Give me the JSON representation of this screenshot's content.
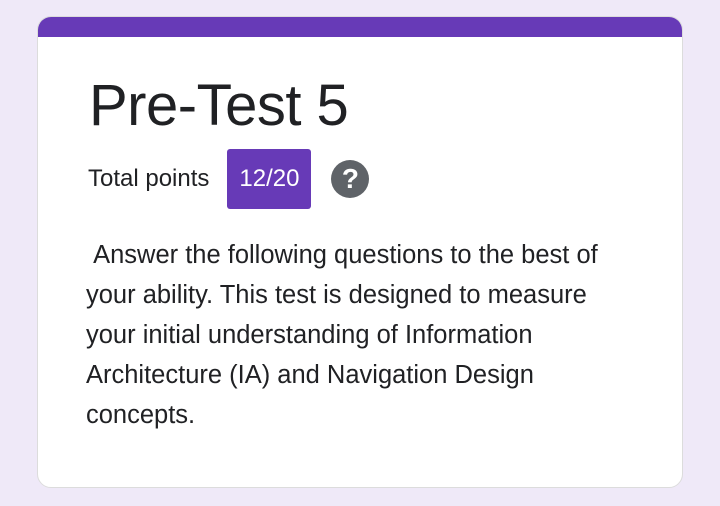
{
  "form": {
    "accent_color": "#673ab7",
    "title": "Pre-Test 5",
    "total_points_label": "Total points",
    "score": "12/20",
    "help_icon": "help-circle-icon",
    "help_glyph": "?",
    "description": " Answer the following questions to the best of your ability. This test is designed to measure your initial understanding of Information Architecture (IA) and Navigation Design concepts."
  }
}
